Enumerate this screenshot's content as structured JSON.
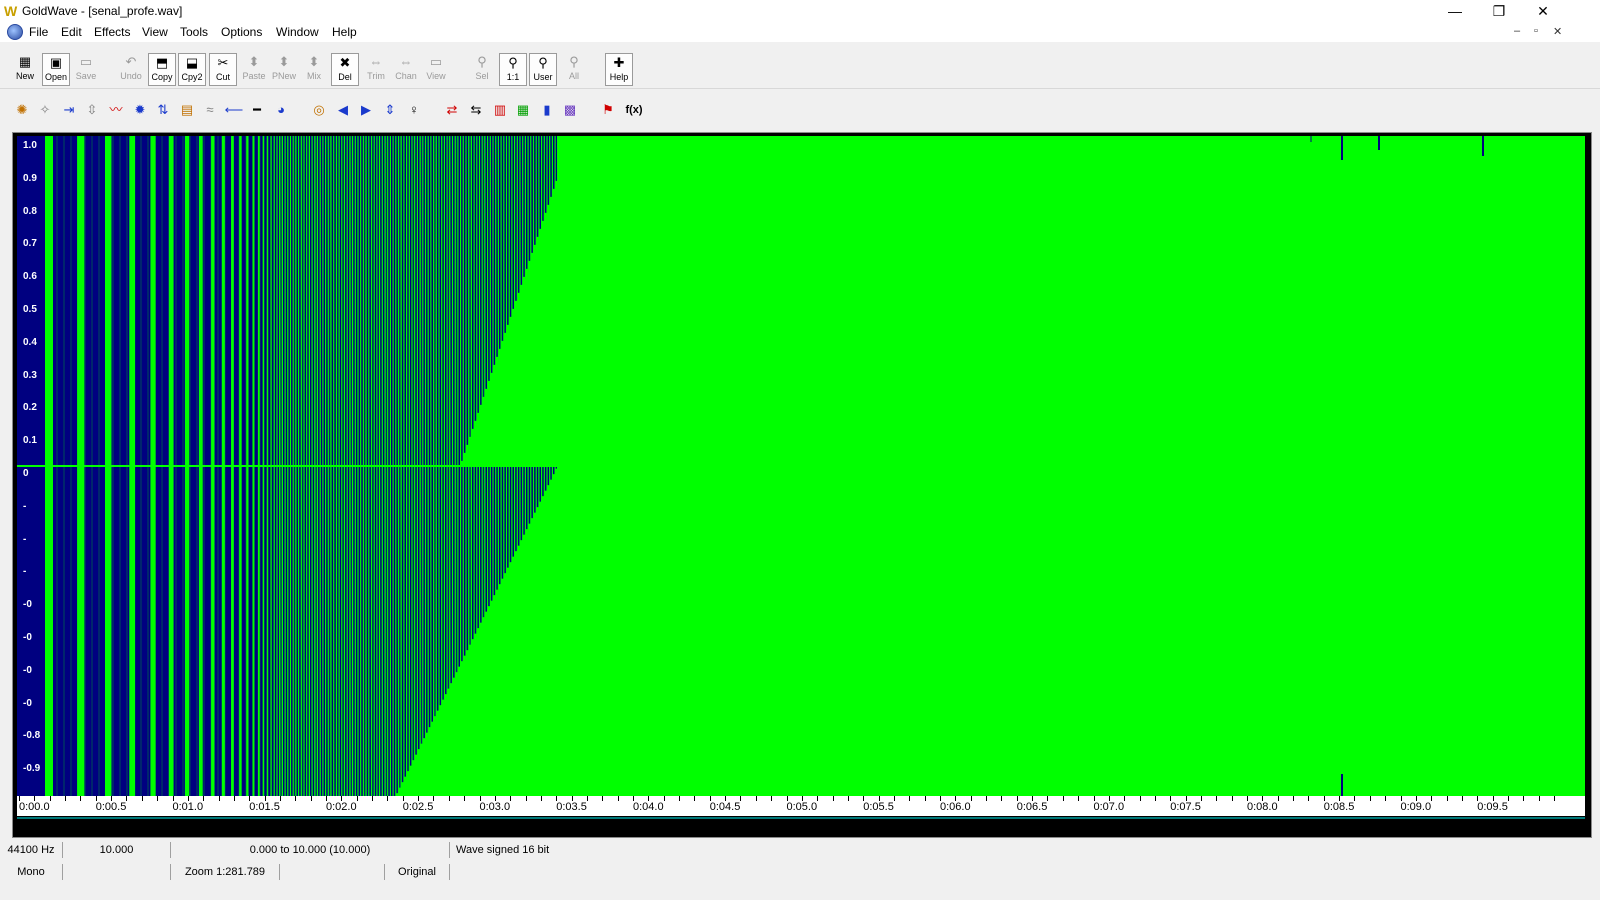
{
  "window": {
    "title": "GoldWave - [senal_profe.wav]",
    "app_icon": "W",
    "minimize": "—",
    "restore": "❐",
    "close": "✕",
    "mdi_min": "–",
    "mdi_restore": "▫",
    "mdi_close": "✕"
  },
  "menu": [
    "File",
    "Edit",
    "Effects",
    "View",
    "Tools",
    "Options",
    "Window",
    "Help"
  ],
  "toolbar": [
    {
      "label": "New",
      "icon": "▦",
      "enabled": true
    },
    {
      "label": "Open",
      "icon": "▣",
      "enabled": true
    },
    {
      "label": "Save",
      "icon": "▭",
      "enabled": false
    },
    {
      "label": "Undo",
      "icon": "↶",
      "enabled": false
    },
    {
      "label": "Copy",
      "icon": "⬒",
      "enabled": true
    },
    {
      "label": "Cpy2",
      "icon": "⬓",
      "enabled": true
    },
    {
      "label": "Cut",
      "icon": "✂",
      "enabled": true
    },
    {
      "label": "Paste",
      "icon": "⬍",
      "enabled": false
    },
    {
      "label": "PNew",
      "icon": "⬍",
      "enabled": false
    },
    {
      "label": "Mix",
      "icon": "⬍",
      "enabled": false
    },
    {
      "label": "Del",
      "icon": "✖",
      "enabled": true
    },
    {
      "label": "Trim",
      "icon": "⇔",
      "enabled": false
    },
    {
      "label": "Chan",
      "icon": "⇔",
      "enabled": false
    },
    {
      "label": "View",
      "icon": "▭",
      "enabled": false
    },
    {
      "label": "Sel",
      "icon": "⚲",
      "enabled": false
    },
    {
      "label": "1:1",
      "icon": "⚲",
      "enabled": true
    },
    {
      "label": "User",
      "icon": "⚲",
      "enabled": true
    },
    {
      "label": "All",
      "icon": "⚲",
      "enabled": false
    },
    {
      "label": "Help",
      "icon": "✚",
      "enabled": true
    }
  ],
  "effects_toolbar": [
    {
      "icon": "✺",
      "color": "#c07000"
    },
    {
      "icon": "✧",
      "color": "#808080"
    },
    {
      "icon": "⇥",
      "color": "#1a3acc"
    },
    {
      "icon": "⇳",
      "color": "#808080"
    },
    {
      "icon": "〰",
      "color": "#d00000"
    },
    {
      "icon": "✹",
      "color": "#1a3acc"
    },
    {
      "icon": "⇅",
      "color": "#1a3acc"
    },
    {
      "icon": "▤",
      "color": "#c07000"
    },
    {
      "icon": "≈",
      "color": "#808080"
    },
    {
      "icon": "⟵",
      "color": "#1a3acc"
    },
    {
      "icon": "━",
      "color": "#000000"
    },
    {
      "icon": "◕",
      "color": "#1a3acc"
    },
    {
      "icon": "◎",
      "color": "#c07000"
    },
    {
      "icon": "◀",
      "color": "#1a3acc"
    },
    {
      "icon": "▶",
      "color": "#1a3acc"
    },
    {
      "icon": "⇕",
      "color": "#1a3acc"
    },
    {
      "icon": "♀",
      "color": "#000000"
    },
    {
      "icon": "⇄",
      "color": "#d00000"
    },
    {
      "icon": "⇆",
      "color": "#000000"
    },
    {
      "icon": "▥",
      "color": "#d00000"
    },
    {
      "icon": "▦",
      "color": "#00a000"
    },
    {
      "icon": "▮",
      "color": "#1a3acc"
    },
    {
      "icon": "▩",
      "color": "#6a3ac0"
    },
    {
      "icon": "⚑",
      "color": "#d00000"
    },
    {
      "icon": "f(x)",
      "color": "#000000"
    }
  ],
  "waveform": {
    "y_labels": [
      "1.0",
      "0.9",
      "0.8",
      "0.7",
      "0.6",
      "0.5",
      "0.4",
      "0.3",
      "0.2",
      "0.1",
      "0",
      "-",
      "-",
      "-",
      "-0",
      "-0",
      "-0",
      "-0",
      "-0.8",
      "-0.9"
    ],
    "colors": {
      "background": "#00ff00",
      "wave": "#000080"
    },
    "time_labels": [
      "0:00.0",
      "0:00.5",
      "0:01.0",
      "0:01.5",
      "0:02.0",
      "0:02.5",
      "0:03.0",
      "0:03.5",
      "0:04.0",
      "0:04.5",
      "0:05.0",
      "0:05.5",
      "0:06.0",
      "0:06.5",
      "0:07.0",
      "0:07.5",
      "0:08.0",
      "0:08.5",
      "0:09.0",
      "0:09.5"
    ],
    "duration_s": 10.0
  },
  "status1": {
    "rate": "44100 Hz",
    "length": "10.000",
    "selection": "0.000 to 10.000  (10.000)",
    "format": "Wave signed 16 bit"
  },
  "status2": {
    "channels": "Mono",
    "zoom": "Zoom 1:281.789",
    "mode": "Original"
  }
}
